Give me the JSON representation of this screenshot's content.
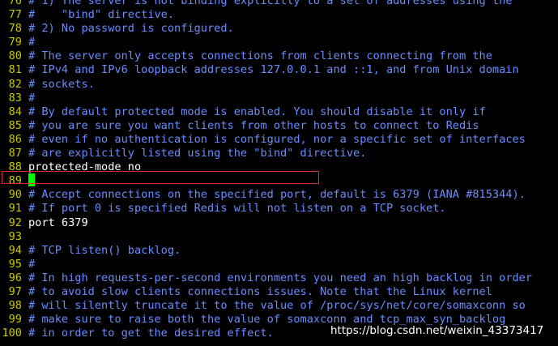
{
  "lines": [
    {
      "num": "76",
      "text": "# 1) The server is not binding explicitly to a set of addresses using the",
      "type": "comment"
    },
    {
      "num": "77",
      "text": "#    \"bind\" directive.",
      "type": "comment"
    },
    {
      "num": "78",
      "text": "# 2) No password is configured.",
      "type": "comment"
    },
    {
      "num": "79",
      "text": "#",
      "type": "comment"
    },
    {
      "num": "80",
      "text": "# The server only accepts connections from clients connecting from the",
      "type": "comment"
    },
    {
      "num": "81",
      "text": "# IPv4 and IPv6 loopback addresses 127.0.0.1 and ::1, and from Unix domain",
      "type": "comment"
    },
    {
      "num": "82",
      "text": "# sockets.",
      "type": "comment"
    },
    {
      "num": "83",
      "text": "#",
      "type": "comment"
    },
    {
      "num": "84",
      "text": "# By default protected mode is enabled. You should disable it only if",
      "type": "comment"
    },
    {
      "num": "85",
      "text": "# you are sure you want clients from other hosts to connect to Redis",
      "type": "comment"
    },
    {
      "num": "86",
      "text": "# even if no authentication is configured, nor a specific set of interfaces",
      "type": "comment"
    },
    {
      "num": "87",
      "text": "# are explicitly listed using the \"bind\" directive.",
      "type": "comment"
    },
    {
      "num": "88",
      "text": "protected-mode no",
      "type": "code"
    },
    {
      "num": "89",
      "text": "",
      "type": "cursor"
    },
    {
      "num": "90",
      "text": "# Accept connections on the specified port, default is 6379 (IANA #815344).",
      "type": "comment"
    },
    {
      "num": "91",
      "text": "# If port 0 is specified Redis will not listen on a TCP socket.",
      "type": "comment"
    },
    {
      "num": "92",
      "text": "port 6379",
      "type": "code"
    },
    {
      "num": "93",
      "text": "",
      "type": "code"
    },
    {
      "num": "94",
      "text": "# TCP listen() backlog.",
      "type": "comment"
    },
    {
      "num": "95",
      "text": "#",
      "type": "comment"
    },
    {
      "num": "96",
      "text": "# In high requests-per-second environments you need an high backlog in order",
      "type": "comment"
    },
    {
      "num": "97",
      "text": "# to avoid slow clients connections issues. Note that the Linux kernel",
      "type": "comment"
    },
    {
      "num": "98",
      "text": "# will silently truncate it to the value of /proc/sys/net/core/somaxconn so",
      "type": "comment"
    },
    {
      "num": "99",
      "text": "# make sure to raise both the value of somaxconn and tcp_max_syn_backlog",
      "type": "comment"
    },
    {
      "num": "100",
      "text": "# in order to get the desired effect.",
      "type": "comment"
    }
  ],
  "watermark": "https://blog.csdn.net/weixin_43373417",
  "colors": {
    "background": "#000000",
    "line_number": "#c8c800",
    "comment": "#6a8cff",
    "code": "#ffffff",
    "cursor": "#00ff00",
    "highlight_box": "#d62b2b"
  }
}
